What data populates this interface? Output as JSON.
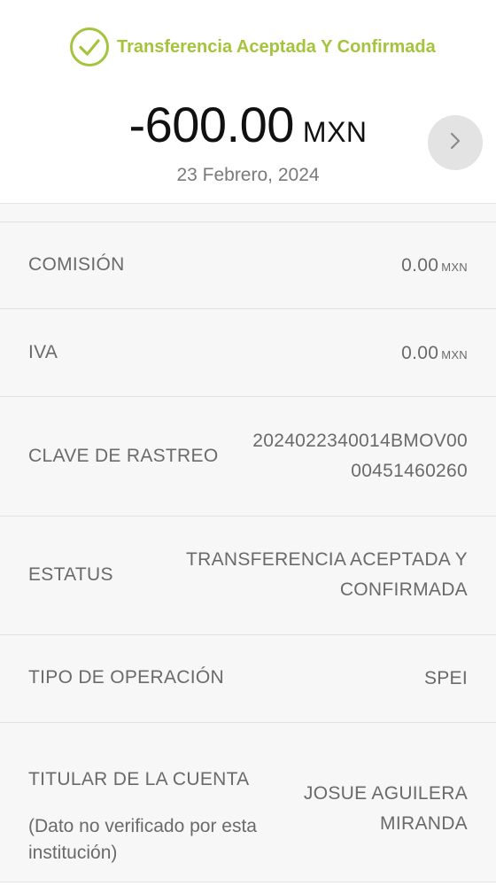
{
  "theme": {
    "accent": "#a4c43c",
    "background": "#ffffff",
    "row_background": "#f7f7f7",
    "button_background": "#e3e3e3"
  },
  "header": {
    "status_icon": "check-circle-icon",
    "status_text": "Transferencia Aceptada Y Confirmada",
    "amount": "-600.00",
    "currency": "MXN",
    "date": "23 Febrero, 2024",
    "next_icon": "chevron-right-icon"
  },
  "details": {
    "comision": {
      "label": "COMISIÓN",
      "value": "0.00",
      "unit": "MXN"
    },
    "iva": {
      "label": "IVA",
      "value": "0.00",
      "unit": "MXN"
    },
    "clave_rastreo": {
      "label": "CLAVE DE RASTREO",
      "value_line1": "2024022340014BMOV00",
      "value_line2": "00451460260"
    },
    "estatus": {
      "label": "ESTATUS",
      "value_line1": "TRANSFERENCIA ACEPTADA Y",
      "value_line2": "CONFIRMADA"
    },
    "tipo_operacion": {
      "label": "TIPO DE OPERACIÓN",
      "value": "SPEI"
    },
    "titular": {
      "label": "TITULAR DE LA CUENTA",
      "note": "(Dato no verificado por esta institución)",
      "value_line1": "JOSUE AGUILERA",
      "value_line2": "MIRANDA"
    }
  }
}
